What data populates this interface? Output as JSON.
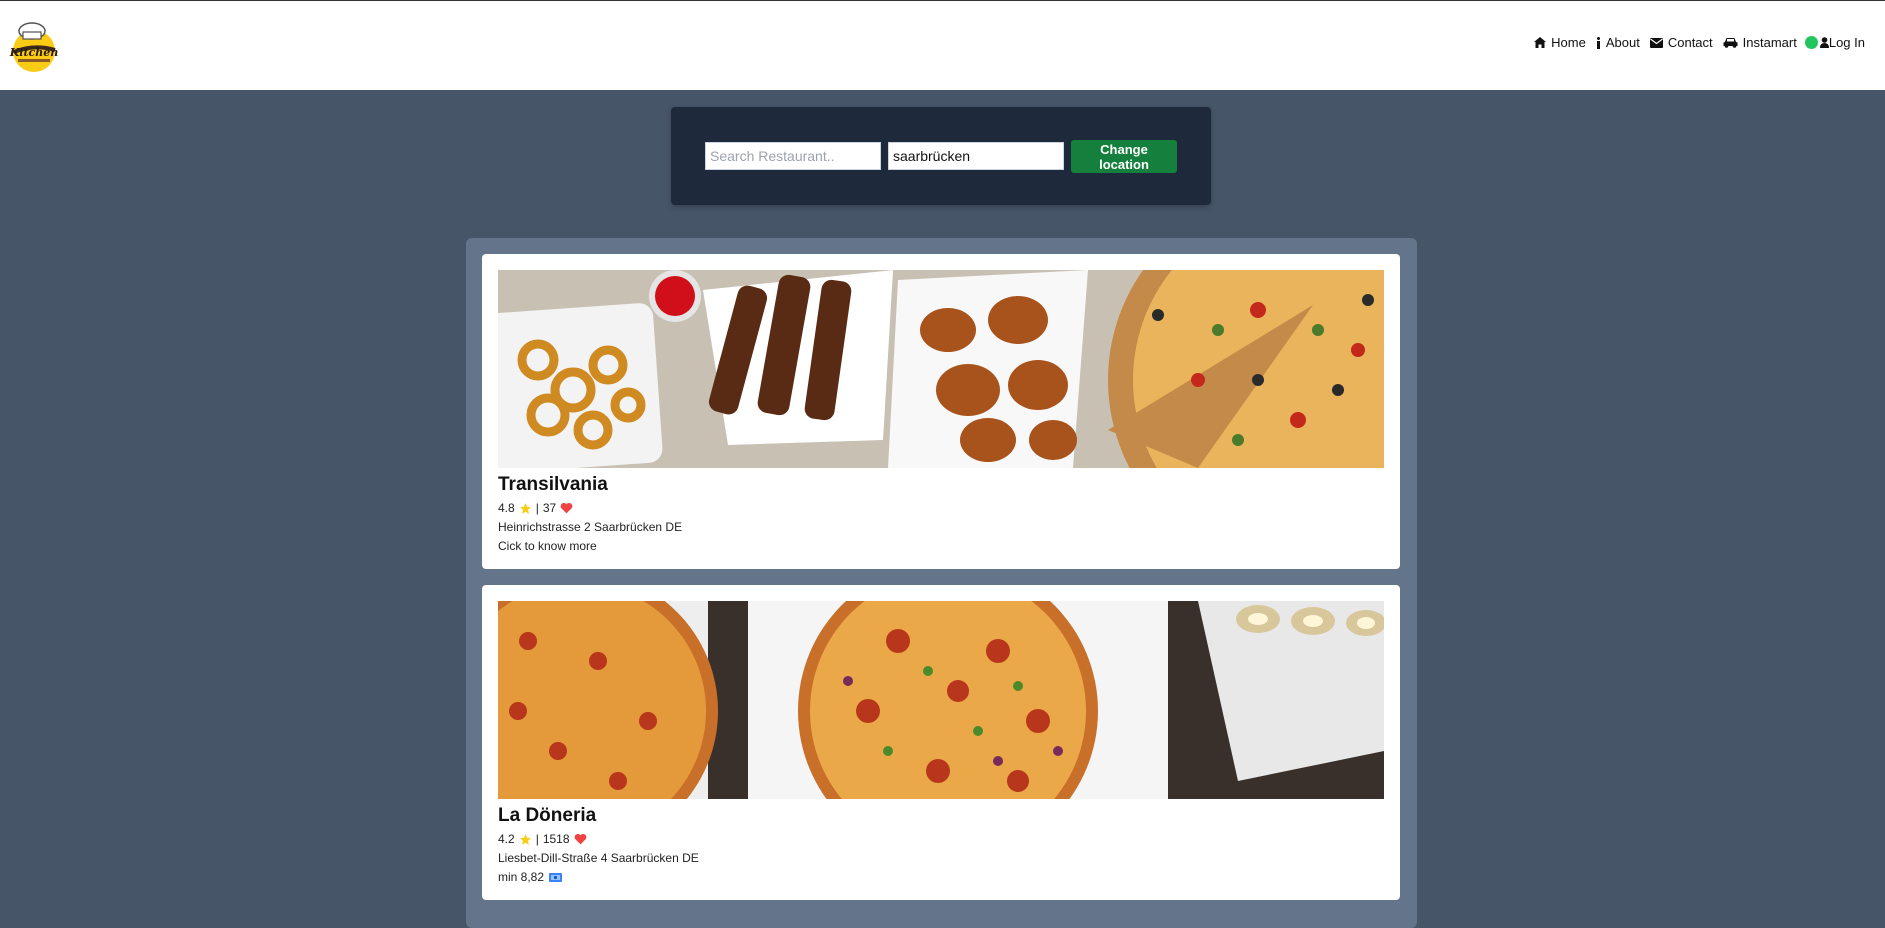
{
  "nav": {
    "items": [
      {
        "label": "Home",
        "icon": "home-icon"
      },
      {
        "label": "About",
        "icon": "info-icon"
      },
      {
        "label": "Contact",
        "icon": "envelope-icon"
      },
      {
        "label": "Instamart",
        "icon": "car-icon"
      }
    ],
    "login_label": "Log In",
    "status_color": "#22c55e"
  },
  "search": {
    "restaurant_placeholder": "Search Restaurant..",
    "restaurant_value": "",
    "location_value": "saarbrücken",
    "change_location_label": "Change location"
  },
  "restaurants": [
    {
      "name": "Transilvania",
      "rating": "4.8",
      "separator": "|",
      "review_count": "37",
      "address": "Heinrichstrasse 2 Saarbrücken DE",
      "extra": "Cick to know more",
      "image": "fried-food-and-pizza-photo"
    },
    {
      "name": "La Döneria",
      "rating": "4.2",
      "separator": "|",
      "review_count": "1518",
      "address": "Liesbet-Dill-Straße 4 Saarbrücken DE",
      "extra": "min 8,82",
      "image": "pizzas-photo"
    }
  ],
  "colors": {
    "page_bg": "#475569",
    "search_panel_bg": "#1e293b",
    "list_panel_bg": "#64748b",
    "button_green": "#15803d",
    "star": "#facc15",
    "heart": "#ef4444"
  }
}
